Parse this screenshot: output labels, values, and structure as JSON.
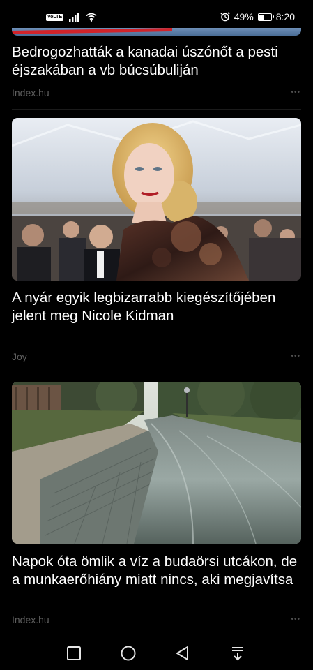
{
  "status_bar": {
    "volte": "VoLTE",
    "battery_percent": "49%",
    "battery_level": 0.49,
    "time": "8:20",
    "icons": [
      "volte-icon",
      "signal-icon",
      "wifi-icon",
      "alarm-icon",
      "battery-icon"
    ]
  },
  "feed": {
    "articles": [
      {
        "title": "Bedrogozhatták a kanadai úszónőt a pesti éjszakában a vb búcsúbuliján",
        "source": "Index.hu"
      },
      {
        "title": "A nyár egyik legbizarrabb kiegészítőjében jelent meg Nicole Kidman",
        "source": "Joy"
      },
      {
        "title": "Napok óta ömlik a víz a budaörsi utcákon, de a munkaerőhiány miatt nincs, aki megjavítsa",
        "source": "Index.hu"
      }
    ],
    "more_icon": "more-dots-icon"
  },
  "nav_bar": {
    "buttons": [
      "recent-apps-icon",
      "home-icon",
      "back-icon",
      "notification-pull-icon"
    ]
  },
  "colors": {
    "background": "#000000",
    "headline": "#ffffff",
    "source": "#5f5f5f"
  }
}
